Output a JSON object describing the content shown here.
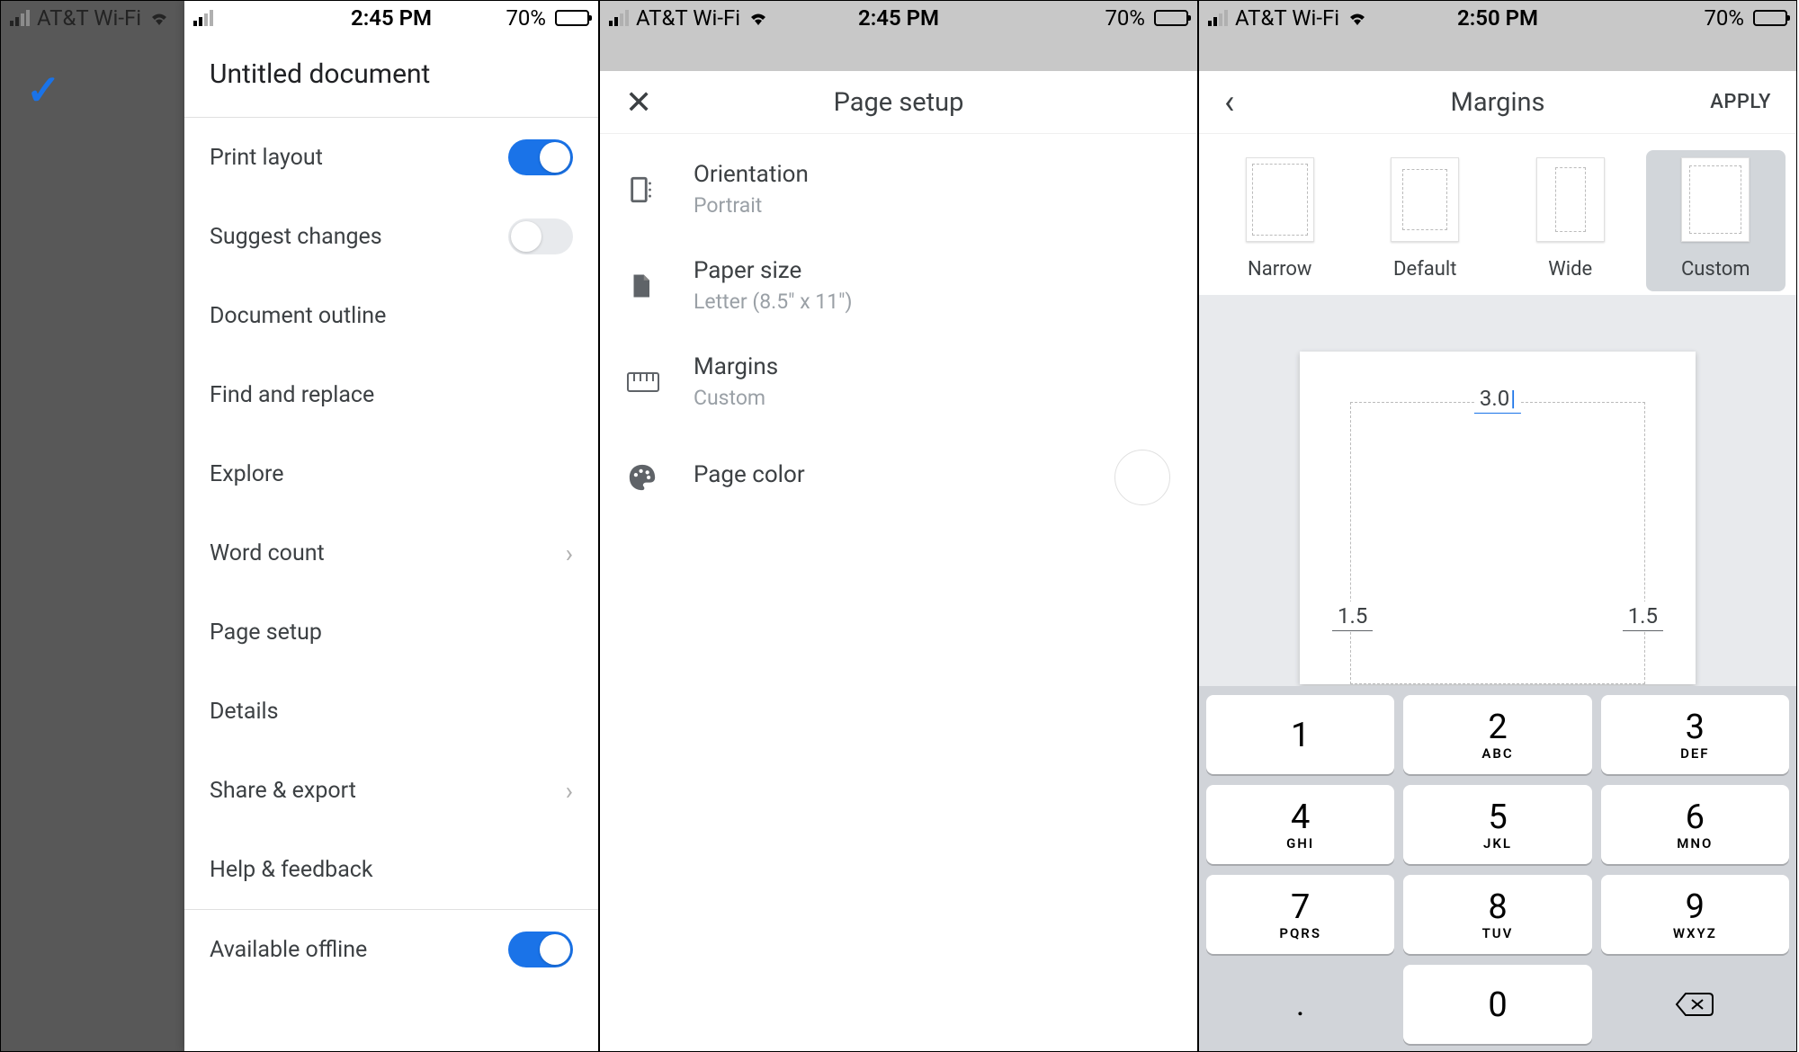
{
  "statusbar": {
    "carrier": "AT&T Wi-Fi",
    "battery_pct": "70%"
  },
  "times": {
    "s1": "2:45 PM",
    "s2": "2:45 PM",
    "s3": "2:50 PM"
  },
  "screen1": {
    "title": "Untitled document",
    "items": {
      "print_layout": "Print layout",
      "suggest_changes": "Suggest changes",
      "document_outline": "Document outline",
      "find_replace": "Find and replace",
      "explore": "Explore",
      "word_count": "Word count",
      "page_setup": "Page setup",
      "details": "Details",
      "share_export": "Share & export",
      "help_feedback": "Help & feedback",
      "available_offline": "Available offline"
    }
  },
  "screen2": {
    "title": "Page setup",
    "orientation": {
      "label": "Orientation",
      "value": "Portrait"
    },
    "paper_size": {
      "label": "Paper size",
      "value": "Letter (8.5\" x 11\")"
    },
    "margins": {
      "label": "Margins",
      "value": "Custom"
    },
    "page_color": {
      "label": "Page color"
    }
  },
  "screen3": {
    "title": "Margins",
    "apply": "APPLY",
    "options": {
      "narrow": "Narrow",
      "default": "Default",
      "wide": "Wide",
      "custom": "Custom"
    },
    "values": {
      "top": "3.0",
      "left": "1.5",
      "right": "1.5"
    }
  },
  "keypad": {
    "k1": {
      "d": "1",
      "s": ""
    },
    "k2": {
      "d": "2",
      "s": "ABC"
    },
    "k3": {
      "d": "3",
      "s": "DEF"
    },
    "k4": {
      "d": "4",
      "s": "GHI"
    },
    "k5": {
      "d": "5",
      "s": "JKL"
    },
    "k6": {
      "d": "6",
      "s": "MNO"
    },
    "k7": {
      "d": "7",
      "s": "PQRS"
    },
    "k8": {
      "d": "8",
      "s": "TUV"
    },
    "k9": {
      "d": "9",
      "s": "WXYZ"
    },
    "k0": {
      "d": "0",
      "s": ""
    },
    "dot": "."
  }
}
